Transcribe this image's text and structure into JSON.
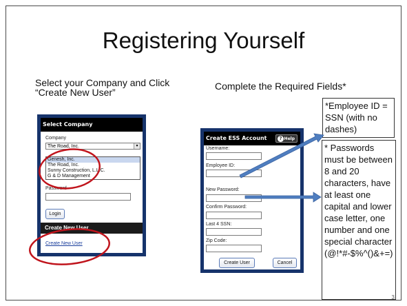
{
  "title": "Registering Yourself",
  "left_instruction": "Select your Company and Click “Create New User”",
  "right_instruction": "Complete the Required Fields*",
  "page_number": "3",
  "select_panel": {
    "header": "Select Company",
    "company_label": "Company",
    "company_value": "The Road, Inc.",
    "options": [
      "Genesh, Inc.",
      "The Road, Inc.",
      "Sunny Construction, L.L.C.",
      "G & D Management"
    ],
    "password_label": "Password",
    "login_label": "Login",
    "create_header": "Create New User",
    "create_link": "Create New User"
  },
  "ess_panel": {
    "header": "Create ESS Account",
    "help_label": "Help",
    "fields": [
      "Username:",
      "Employee ID:",
      "New Password:",
      "Confirm Password:",
      "Last 4 SSN:",
      "Zip Code:"
    ],
    "create_button": "Create User",
    "cancel_button": "Cancel"
  },
  "callouts": {
    "employee_id": "*Employee ID = SSN (with no dashes)",
    "password": "* Passwords must be between 8 and 20 characters, have at least one capital and lower case letter, one number and one special character (@!*#-$%^()&+=)"
  },
  "colors": {
    "panel_border": "#16336b",
    "circle": "#c0141c",
    "arrow": "#4f7ec0"
  }
}
